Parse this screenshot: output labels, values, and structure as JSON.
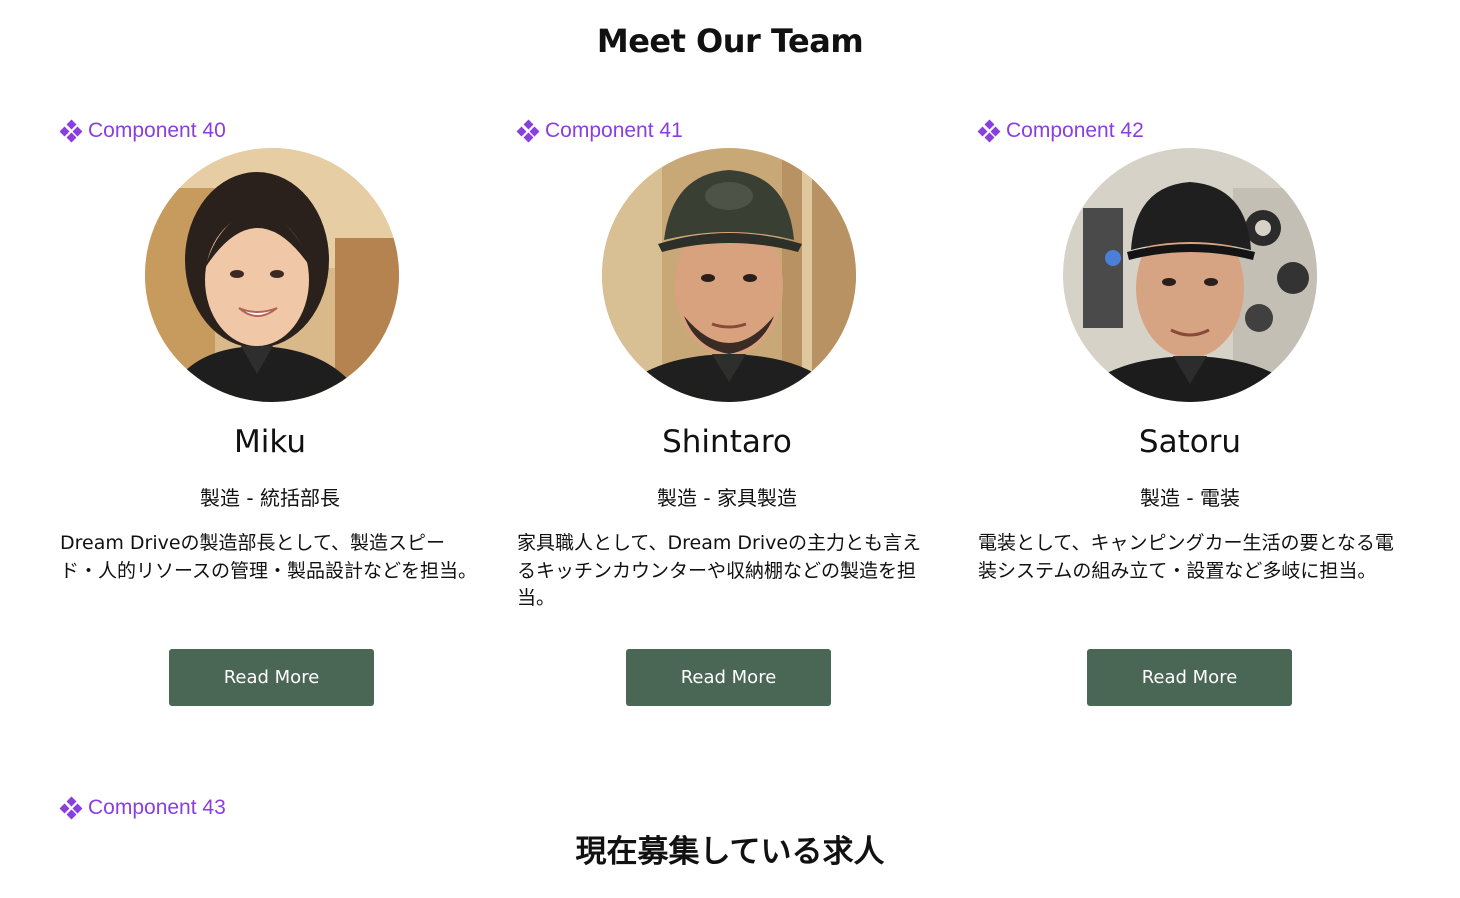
{
  "team_section": {
    "title": "Meet Our Team"
  },
  "members": [
    {
      "component_label": "Component 40",
      "name": "Miku",
      "role": "製造 - 統括部長",
      "description": "Dream Driveの製造部長として、製造スピード・人的リソースの管理・製品設計などを担当。",
      "button_label": "Read More"
    },
    {
      "component_label": "Component 41",
      "name": "Shintaro",
      "role": "製造 - 家具製造",
      "description": "家具職人として、Dream Driveの主力とも言えるキッチンカウンターや収納棚などの製造を担当。",
      "button_label": "Read More"
    },
    {
      "component_label": "Component 42",
      "name": "Satoru",
      "role": "製造 - 電装",
      "description": "電装として、キャンピングカー生活の要となる電装システムの組み立て・設置など多岐に担当。",
      "button_label": "Read More"
    }
  ],
  "jobs_section": {
    "component_label": "Component 43",
    "title": "現在募集している求人"
  },
  "colors": {
    "component_accent": "#8a3ee0",
    "button_bg": "#4a6655",
    "button_text": "#ffffff"
  },
  "icons": {
    "component": "component-diamond-icon"
  }
}
